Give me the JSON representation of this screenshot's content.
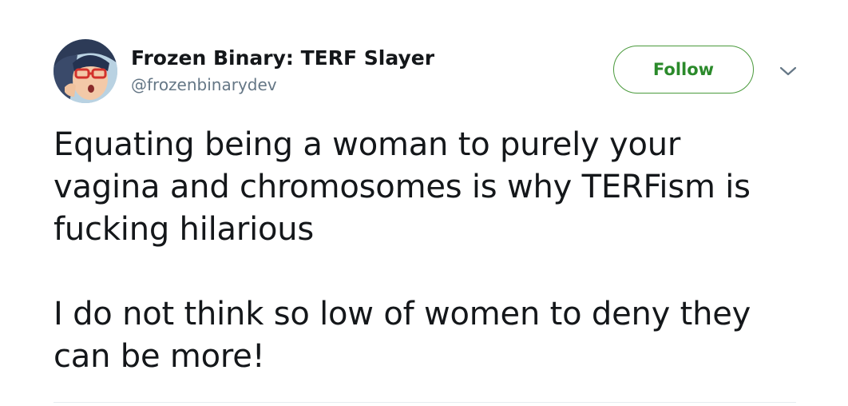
{
  "author": {
    "display_name": "Frozen Binary: TERF Slayer",
    "handle": "@frozenbinarydev"
  },
  "actions": {
    "follow_label": "Follow",
    "more_icon": "chevron-down-icon"
  },
  "tweet": {
    "lines_p1": [
      "Equating being a woman to purely your",
      "vagina and chromosomes is why TERFism is",
      "fucking hilarious"
    ],
    "lines_p2": [
      "I do not think so low of women to deny they",
      "can be more!"
    ]
  },
  "colors": {
    "follow_text": "#2b8a2b",
    "follow_border": "#4a9a3c",
    "handle": "#657786",
    "text": "#14171a"
  }
}
